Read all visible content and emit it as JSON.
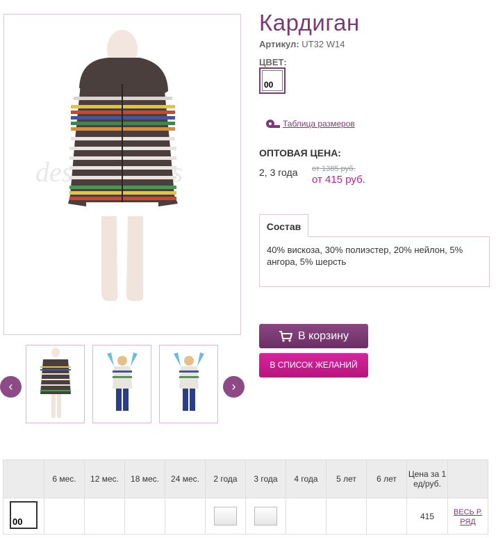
{
  "product": {
    "title": "Кардиган",
    "sku_label": "Артикул:",
    "sku_value": "UT32 W14",
    "color_label": "ЦВЕТ:",
    "color_code": "00",
    "watermark": "designer kids"
  },
  "links": {
    "size_table": "Таблица размеров"
  },
  "pricing": {
    "label": "ОПТОВАЯ ЦЕНА:",
    "age": "2, 3 года",
    "old_price": "от 1385 руб.",
    "new_price": "от 415 руб."
  },
  "tabs": [
    {
      "label": "Состав"
    }
  ],
  "composition": "40% вискоза, 30% полиэстер, 20% нейлон, 5% ангора, 5% шерсть",
  "buttons": {
    "cart": "В корзину",
    "wishlist": "В СПИСОК ЖЕЛАНИЙ"
  },
  "carousel": {
    "prev": "‹",
    "next": "›"
  },
  "grid": {
    "headers": [
      "6 мес.",
      "12 мес.",
      "18 мес.",
      "24 мес.",
      "2 года",
      "3 года",
      "4 года",
      "5 лет",
      "6 лет"
    ],
    "price_header": "Цена за 1 ед/руб.",
    "row": {
      "color_code": "00",
      "available": [
        false,
        false,
        false,
        false,
        true,
        true,
        false,
        false,
        false
      ],
      "price": "415",
      "all_link": "ВЕСЬ Р. РЯД"
    }
  },
  "colors": {
    "accent": "#7b3a75",
    "pink": "#c51d8a"
  }
}
